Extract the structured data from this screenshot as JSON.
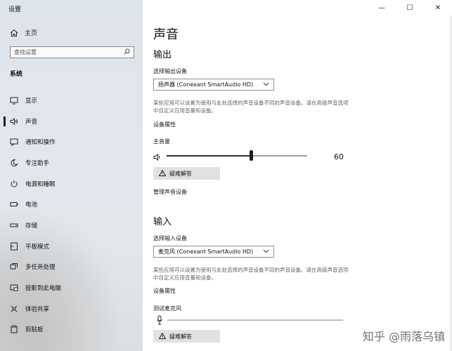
{
  "window": {
    "title": "设置",
    "minimize": "—",
    "maximize": "☐",
    "close": "✕"
  },
  "sidebar": {
    "home_label": "主页",
    "search_placeholder": "查找设置",
    "section_label": "系统",
    "items": [
      {
        "label": "显示",
        "icon": "display-icon"
      },
      {
        "label": "声音",
        "icon": "speaker-icon",
        "active": true
      },
      {
        "label": "通知和操作",
        "icon": "notification-icon"
      },
      {
        "label": "专注助手",
        "icon": "moon-icon"
      },
      {
        "label": "电源和睡眠",
        "icon": "power-icon"
      },
      {
        "label": "电池",
        "icon": "battery-icon"
      },
      {
        "label": "存储",
        "icon": "storage-icon"
      },
      {
        "label": "平板模式",
        "icon": "tablet-icon"
      },
      {
        "label": "多任务处理",
        "icon": "multitask-icon"
      },
      {
        "label": "投影到此电脑",
        "icon": "project-icon"
      },
      {
        "label": "体验共享",
        "icon": "share-icon"
      },
      {
        "label": "剪贴板",
        "icon": "clipboard-icon"
      }
    ]
  },
  "main": {
    "title": "声音",
    "output": {
      "heading": "输出",
      "device_label": "选择输出设备",
      "device_value": "扬声器 (Conexant SmartAudio HD)",
      "note": "某些应用可以设置为使用与此处选择的声音设备不同的声音设备。请在高级声音选项中自定义应用音量和设备。",
      "properties_link": "设备属性",
      "volume_label": "主音量",
      "volume_value": "60",
      "volume_level": 0.6,
      "troubleshoot_label": "疑难解答",
      "manage_link": "管理声音设备"
    },
    "input": {
      "heading": "输入",
      "device_label": "选择输入设备",
      "device_value": "麦克风 (Conexant SmartAudio HD)",
      "note": "某些应用可以设置为使用与此处选择的声音设备不同的声音设备。请在高级声音选项中自定义应用音量和设备。",
      "properties_link": "设备属性",
      "test_label": "测试麦克风",
      "troubleshoot_label": "疑难解答"
    }
  },
  "watermark": "知乎 @雨落乌镇"
}
